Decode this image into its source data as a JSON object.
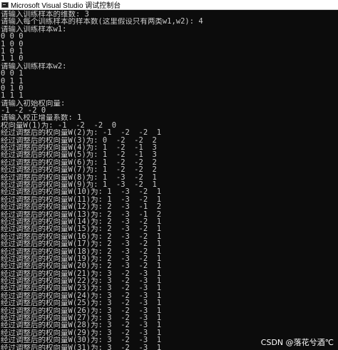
{
  "window": {
    "title": "Microsoft Visual Studio 调试控制台",
    "icon": "console-app-icon"
  },
  "console": {
    "lines": [
      "请输入训练样本的维数: 3",
      "请输入每个训练样本的样本数(这里假设只有两类w1,w2): 4",
      "请输入训练样本w1:",
      "0 0 0",
      "1 0 0",
      "1 0 1",
      "1 1 0",
      "请输入训练样本w2:",
      "0 0 1",
      "0 1 1",
      "0 1 0",
      "1 1 1",
      "请输入初始权向量:",
      "-1 -2 -2 0",
      "请输入校正增量系数: 1",
      "权向量W(1)为: -1  -2  -2  0",
      "经过调整后的权向量W(2)为: -1  -2  -2  1",
      "经过调整后的权向量W(3)为: 0  -2  -2  2",
      "经过调整后的权向量W(4)为: 1  -2  -1  3",
      "经过调整后的权向量W(5)为: 1  -2  -1  3",
      "经过调整后的权向量W(6)为: 1  -2  -2  2",
      "经过调整后的权向量W(7)为: 1  -2  -2  2",
      "经过调整后的权向量W(8)为: 1  -3  -2  1",
      "经过调整后的权向量W(9)为: 1  -3  -2  1",
      "经过调整后的权向量W(10)为: 1  -3  -2  1",
      "经过调整后的权向量W(11)为: 1  -3  -2  1",
      "经过调整后的权向量W(12)为: 2  -3  -1  2",
      "经过调整后的权向量W(13)为: 2  -3  -1  2",
      "经过调整后的权向量W(14)为: 2  -3  -2  1",
      "经过调整后的权向量W(15)为: 2  -3  -2  1",
      "经过调整后的权向量W(16)为: 2  -3  -2  1",
      "经过调整后的权向量W(17)为: 2  -3  -2  1",
      "经过调整后的权向量W(18)为: 2  -3  -2  1",
      "经过调整后的权向量W(19)为: 2  -3  -2  1",
      "经过调整后的权向量W(20)为: 2  -3  -2  1",
      "经过调整后的权向量W(21)为: 3  -2  -3  1",
      "经过调整后的权向量W(22)为: 3  -2  -3  1",
      "经过调整后的权向量W(23)为: 3  -2  -3  1",
      "经过调整后的权向量W(24)为: 3  -2  -3  1",
      "经过调整后的权向量W(25)为: 3  -2  -3  1",
      "经过调整后的权向量W(26)为: 3  -2  -3  1",
      "经过调整后的权向量W(27)为: 3  -2  -3  1",
      "经过调整后的权向量W(28)为: 3  -2  -3  1",
      "经过调整后的权向量W(29)为: 3  -2  -3  1",
      "经过调整后的权向量W(30)为: 3  -2  -3  1",
      "经过调整后的权向量W(31)为: 3  -2  -3  1",
      "经过调整后的权向量W(32)为: 3  -2  -3  1",
      "经过调整后的权向量W(33)为: 3  -2  -3  1"
    ]
  },
  "watermark": {
    "text": "CSDN @落花兮酒℃"
  },
  "colors": {
    "background": "#0c0c0c",
    "text": "#cccccc",
    "titlebar": "#ffffff"
  }
}
